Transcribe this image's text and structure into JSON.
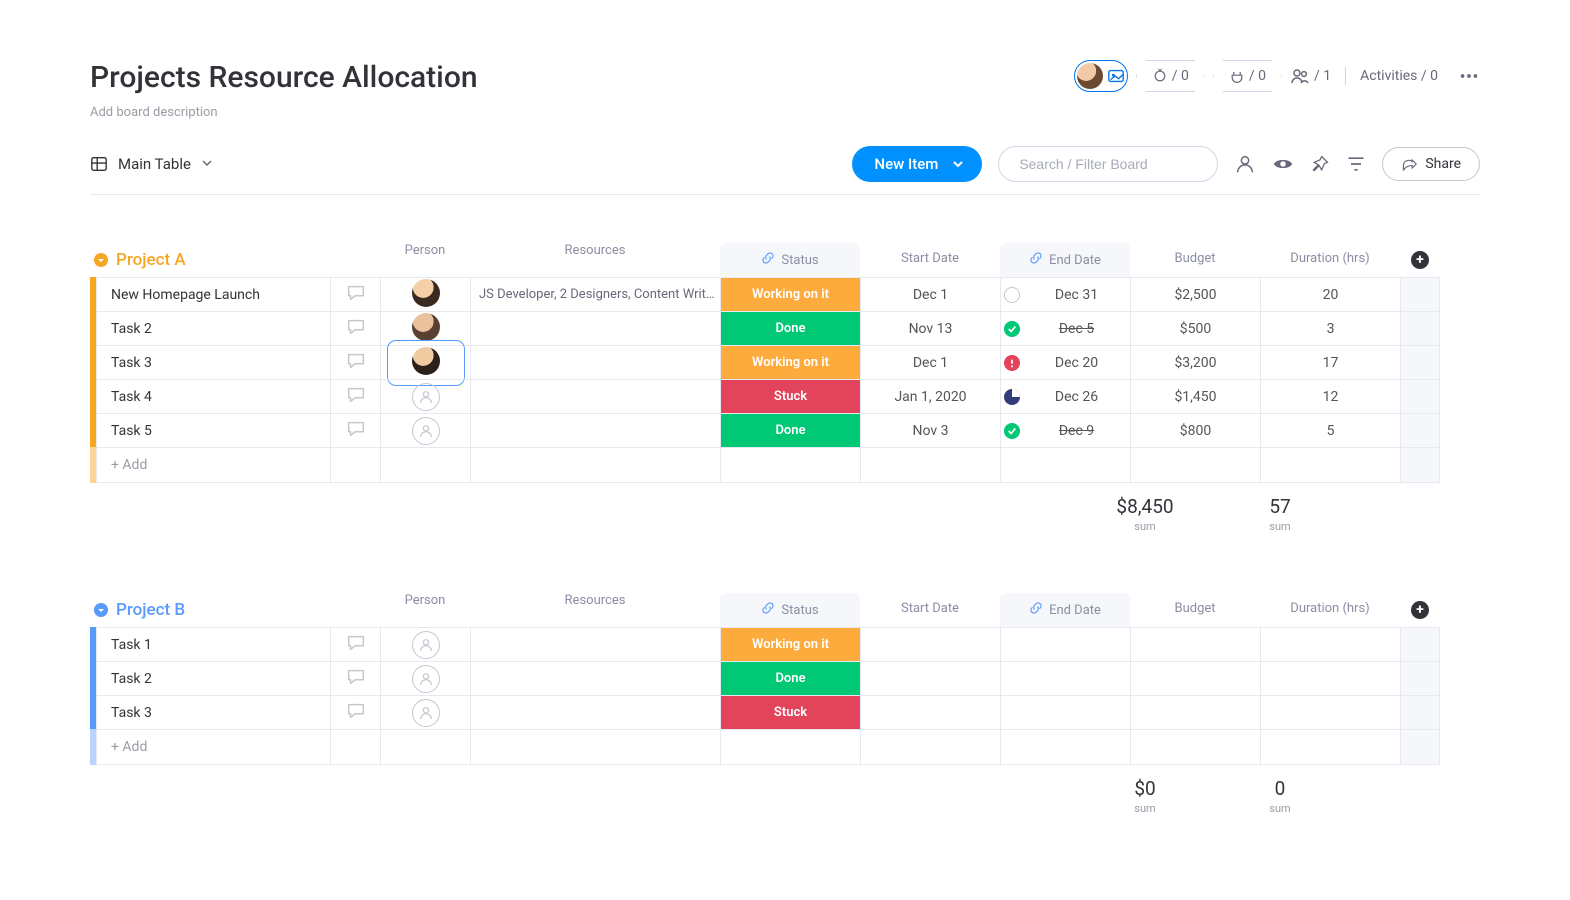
{
  "header": {
    "title": "Projects Resource Allocation",
    "description_placeholder": "Add board description",
    "automations": "/ 0",
    "integrations": "/ 0",
    "members": "/ 1",
    "activities_label": "Activities / 0"
  },
  "toolbar": {
    "view_label": "Main Table",
    "new_item_label": "New Item",
    "search_placeholder": "Search / Filter Board",
    "share_label": "Share"
  },
  "columns": {
    "person": "Person",
    "resources": "Resources",
    "status": "Status",
    "start": "Start Date",
    "end": "End Date",
    "budget": "Budget",
    "duration": "Duration (hrs)"
  },
  "status_labels": {
    "working": "Working on it",
    "done": "Done",
    "stuck": "Stuck"
  },
  "add_label": "+ Add",
  "sum_label": "sum",
  "groups": [
    {
      "name": "Project A",
      "color": "orange",
      "rows": [
        {
          "name": "New Homepage Launch",
          "person": "a1",
          "resources": "JS Developer, 2 Designers, Content Writ…",
          "status": "working",
          "start": "Dec 1",
          "end": "Dec 31",
          "end_state": "empty",
          "budget": "$2,500",
          "duration": "20"
        },
        {
          "name": "Task 2",
          "person": "a2",
          "resources": "",
          "status": "done",
          "start": "Nov 13",
          "end": "Dec 5",
          "end_state": "done",
          "end_strike": true,
          "budget": "$500",
          "duration": "3"
        },
        {
          "name": "Task 3",
          "person": "a3",
          "person_selected": true,
          "resources": "",
          "status": "working",
          "start": "Dec 1",
          "end": "Dec 20",
          "end_state": "warn",
          "budget": "$3,200",
          "duration": "17"
        },
        {
          "name": "Task 4",
          "person": "",
          "resources": "",
          "status": "stuck",
          "start": "Jan 1, 2020",
          "end": "Dec 26",
          "end_state": "prog",
          "budget": "$1,450",
          "duration": "12"
        },
        {
          "name": "Task 5",
          "person": "",
          "resources": "",
          "status": "done",
          "start": "Nov 3",
          "end": "Dec 9",
          "end_state": "done",
          "end_strike": true,
          "budget": "$800",
          "duration": "5"
        }
      ],
      "sum_budget": "$8,450",
      "sum_duration": "57"
    },
    {
      "name": "Project B",
      "color": "blue",
      "rows": [
        {
          "name": "Task 1",
          "person": "",
          "resources": "",
          "status": "working",
          "start": "",
          "end": "",
          "budget": "",
          "duration": ""
        },
        {
          "name": "Task 2",
          "person": "",
          "resources": "",
          "status": "done",
          "start": "",
          "end": "",
          "budget": "",
          "duration": ""
        },
        {
          "name": "Task 3",
          "person": "",
          "resources": "",
          "status": "stuck",
          "start": "",
          "end": "",
          "budget": "",
          "duration": ""
        }
      ],
      "sum_budget": "$0",
      "sum_duration": "0"
    }
  ]
}
